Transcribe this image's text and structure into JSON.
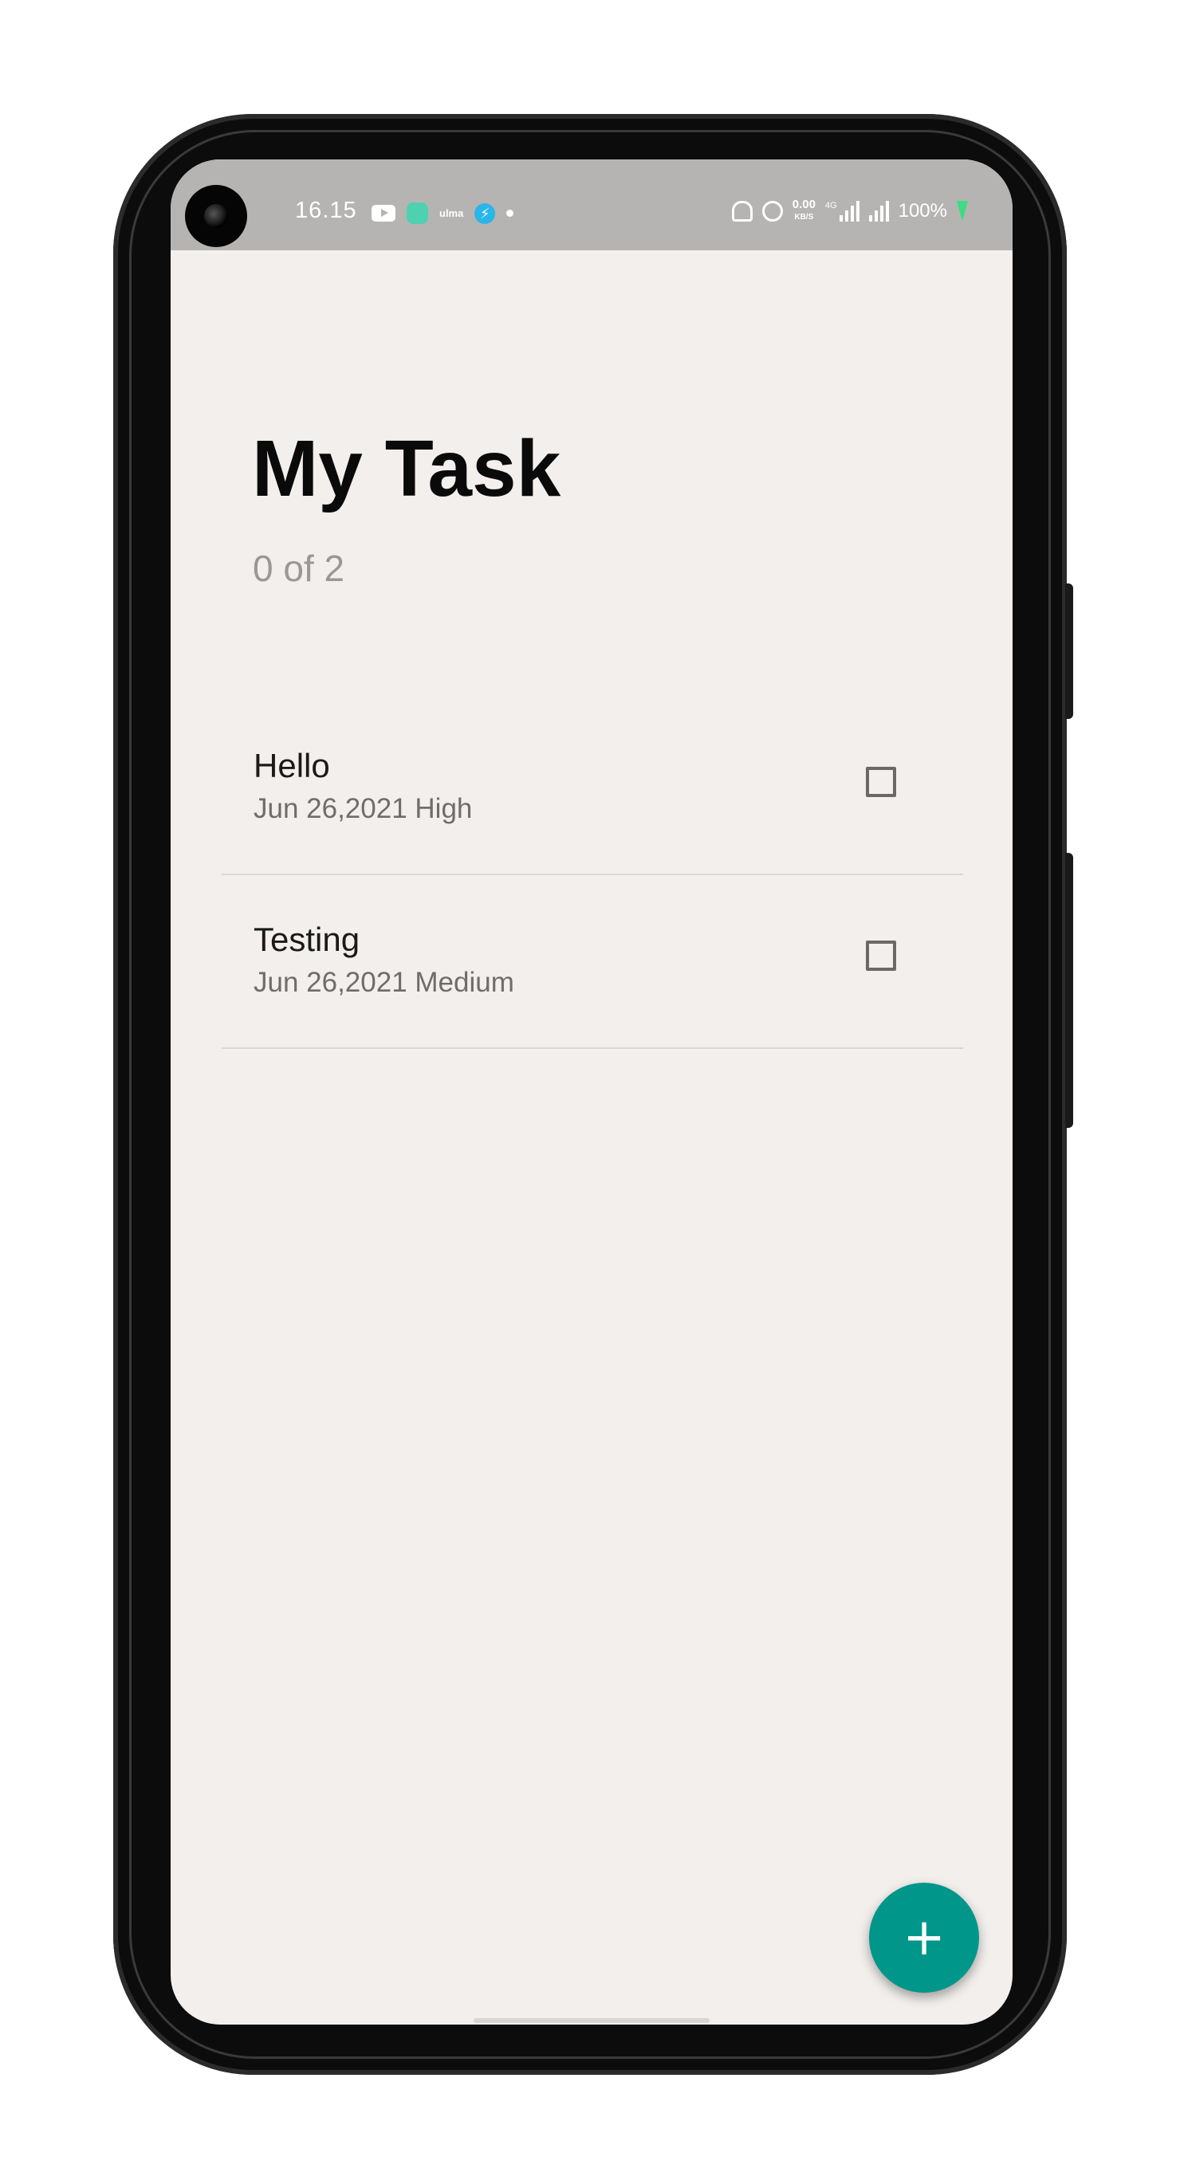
{
  "status_bar": {
    "time": "16.15",
    "small_icon_text": "ulma",
    "network_speed_value": "0.00",
    "network_speed_unit": "KB/S",
    "network_type": "4G",
    "battery": "100%"
  },
  "app": {
    "title": "My Task",
    "progress_text": "0 of 2"
  },
  "tasks": [
    {
      "name": "Hello",
      "meta": "Jun 26,2021 High",
      "completed": false
    },
    {
      "name": "Testing",
      "meta": "Jun 26,2021 Medium",
      "completed": false
    }
  ],
  "fab": {
    "label": "+",
    "icon": "plus-icon",
    "color": "#00968a"
  },
  "colors": {
    "background": "#f2efec",
    "status_bar": "#b5b4b2",
    "accent": "#00968a"
  }
}
